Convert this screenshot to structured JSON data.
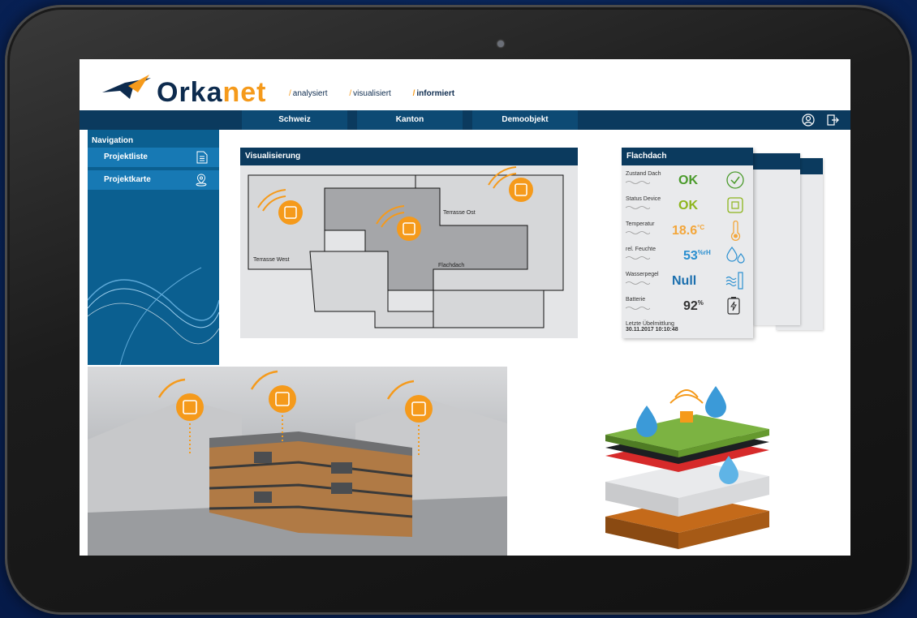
{
  "brand": {
    "name_part1": "Orka",
    "name_part2": "net",
    "tagline": [
      "analysiert",
      "visualisiert",
      "informiert"
    ]
  },
  "topnav": {
    "tabs": [
      "Schweiz",
      "Kanton",
      "Demoobjekt"
    ]
  },
  "sidebar": {
    "title": "Navigation",
    "items": [
      {
        "label": "Projektliste",
        "icon": "document-list-icon"
      },
      {
        "label": "Projektkarte",
        "icon": "map-pin-icon"
      }
    ]
  },
  "visualization": {
    "title": "Visualisierung",
    "zones": [
      "Terrasse Ost",
      "Terrasse West",
      "Flachdach"
    ]
  },
  "sensor_panel": {
    "title": "Flachdach",
    "rows": [
      {
        "label": "Zustand Dach",
        "value": "OK",
        "unit": "",
        "color": "#4a9a2b",
        "icon": "check-circle-icon"
      },
      {
        "label": "Status Device",
        "value": "OK",
        "unit": "",
        "color": "#8db51c",
        "icon": "device-chip-icon"
      },
      {
        "label": "Temperatur",
        "value": "18.6",
        "unit": "°C",
        "color": "#f3a63a",
        "icon": "thermometer-icon"
      },
      {
        "label": "rel. Feuchte",
        "value": "53",
        "unit": "%rH",
        "color": "#2a8fd0",
        "icon": "humidity-drops-icon"
      },
      {
        "label": "Wasserpegel",
        "value": "Null",
        "unit": "",
        "color": "#1b6fae",
        "icon": "water-level-icon"
      },
      {
        "label": "Batterie",
        "value": "92",
        "unit": "%",
        "color": "#333333",
        "icon": "battery-icon"
      }
    ],
    "last_message_label": "Letzte Übelmittlung",
    "last_message_value": "30.11.2017   10:10:48"
  },
  "colors": {
    "navy": "#0b3a5e",
    "accent_orange": "#f59a1b",
    "sidebar_blue": "#0b5f90"
  }
}
